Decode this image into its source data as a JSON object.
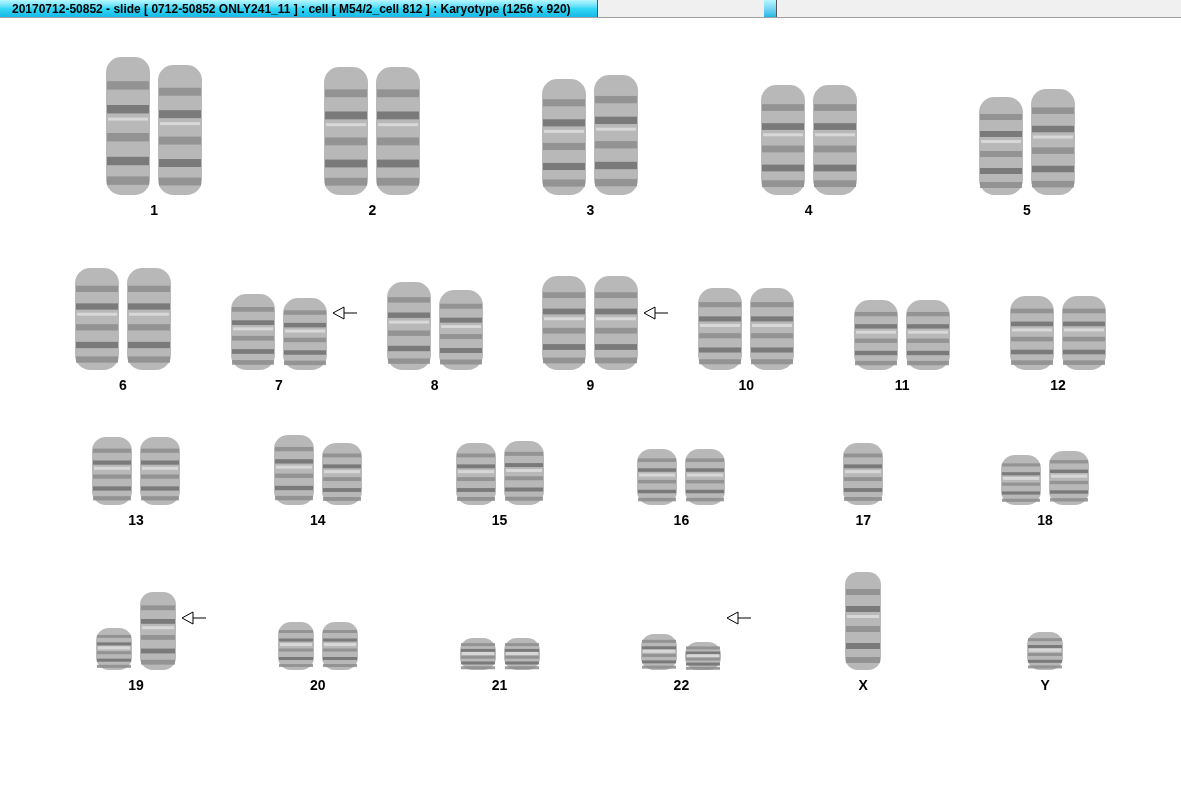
{
  "window": {
    "title": "20170712-50852 - slide [ 0712-50852 ONLY241_11 ] : cell [ M54/2_cell 812 ] : Karyotype  (1256 x 920)"
  },
  "rows": [
    {
      "items": [
        {
          "label": "1",
          "kind": "pair",
          "arrow": false
        },
        {
          "label": "2",
          "kind": "pair",
          "arrow": false
        },
        {
          "label": "3",
          "kind": "pair",
          "arrow": false
        },
        {
          "label": "4",
          "kind": "pair",
          "arrow": false
        },
        {
          "label": "5",
          "kind": "pair",
          "arrow": false
        }
      ]
    },
    {
      "items": [
        {
          "label": "6",
          "kind": "pair",
          "arrow": false
        },
        {
          "label": "7",
          "kind": "pair",
          "arrow": true
        },
        {
          "label": "8",
          "kind": "pair",
          "arrow": false
        },
        {
          "label": "9",
          "kind": "pair",
          "arrow": true
        },
        {
          "label": "10",
          "kind": "pair",
          "arrow": false
        },
        {
          "label": "11",
          "kind": "pair",
          "arrow": false
        },
        {
          "label": "12",
          "kind": "pair",
          "arrow": false
        }
      ]
    },
    {
      "items": [
        {
          "label": "13",
          "kind": "pair",
          "arrow": false
        },
        {
          "label": "14",
          "kind": "pair",
          "arrow": false
        },
        {
          "label": "15",
          "kind": "pair",
          "arrow": false
        },
        {
          "label": "16",
          "kind": "pair",
          "arrow": false
        },
        {
          "label": "17",
          "kind": "single",
          "arrow": false
        },
        {
          "label": "18",
          "kind": "pair",
          "arrow": false
        }
      ]
    },
    {
      "items": [
        {
          "label": "19",
          "kind": "pair",
          "arrow": true
        },
        {
          "label": "20",
          "kind": "pair",
          "arrow": false
        },
        {
          "label": "21",
          "kind": "pair",
          "arrow": false
        },
        {
          "label": "22",
          "kind": "pair",
          "arrow": true
        },
        {
          "label": "X",
          "kind": "single",
          "arrow": false
        },
        {
          "label": "Y",
          "kind": "single",
          "arrow": false
        }
      ]
    }
  ]
}
